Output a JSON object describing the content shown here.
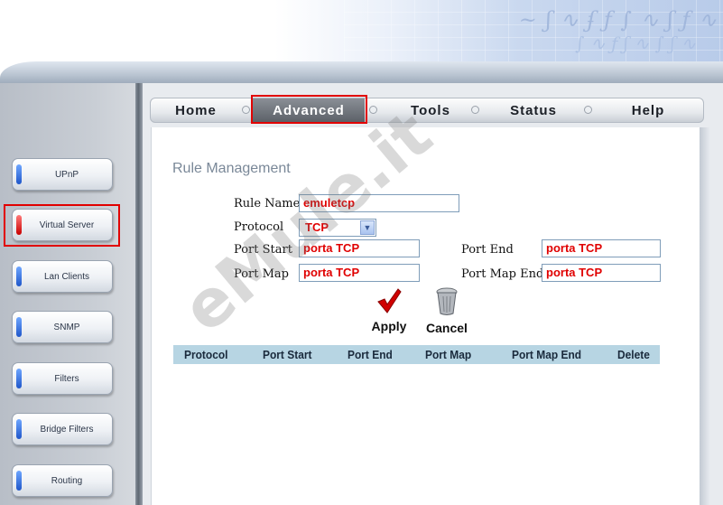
{
  "watermark": "eMule.it",
  "colors": {
    "highlight": "#e10000",
    "value_text": "#e00000",
    "table_header_bg": "#b7d5e3"
  },
  "sidebar": {
    "items": [
      {
        "label": "UPnP"
      },
      {
        "label": "Virtual Server"
      },
      {
        "label": "Lan Clients"
      },
      {
        "label": "SNMP"
      },
      {
        "label": "Filters"
      },
      {
        "label": "Bridge Filters"
      },
      {
        "label": "Routing"
      }
    ],
    "active": "Virtual Server"
  },
  "tabs": {
    "items": [
      {
        "label": "Home"
      },
      {
        "label": "Advanced"
      },
      {
        "label": "Tools"
      },
      {
        "label": "Status"
      },
      {
        "label": "Help"
      }
    ],
    "active": "Advanced"
  },
  "form": {
    "title": "Rule Management",
    "rule_name": {
      "label": "Rule Name",
      "value": "emuletcp"
    },
    "protocol": {
      "label": "Protocol",
      "value": "TCP"
    },
    "port_start": {
      "label": "Port Start",
      "value": "porta TCP"
    },
    "port_end": {
      "label": "Port End",
      "value": "porta TCP"
    },
    "port_map": {
      "label": "Port Map",
      "value": "porta TCP"
    },
    "port_map_end": {
      "label": "Port Map End",
      "value": "porta TCP"
    },
    "apply_label": "Apply",
    "cancel_label": "Cancel",
    "apply_icon": "checkmark-icon",
    "cancel_icon": "trash-can-icon"
  },
  "table": {
    "headers": [
      "Protocol",
      "Port Start",
      "Port End",
      "Port Map",
      "Port Map End",
      "Delete"
    ]
  }
}
